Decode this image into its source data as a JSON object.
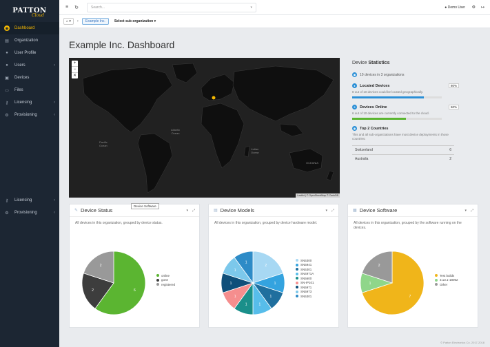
{
  "logo": {
    "line1": "PATTON",
    "line2": "Cloud"
  },
  "sidebar": {
    "items": [
      {
        "label": "Dashboard",
        "icon": "dashboard-icon",
        "glyph": "◉",
        "chev": ""
      },
      {
        "label": "Organization",
        "icon": "organization-icon",
        "glyph": "▤",
        "chev": ""
      },
      {
        "label": "User Profile",
        "icon": "user-icon",
        "glyph": "●",
        "chev": ""
      },
      {
        "label": "Users",
        "icon": "users-icon",
        "glyph": "●",
        "chev": "‹"
      },
      {
        "label": "Devices",
        "icon": "devices-icon",
        "glyph": "▣",
        "chev": ""
      },
      {
        "label": "Files",
        "icon": "files-icon",
        "glyph": "▭",
        "chev": ""
      },
      {
        "label": "Licensing",
        "icon": "key-icon",
        "glyph": "⚷",
        "chev": "‹"
      },
      {
        "label": "Provisioning",
        "icon": "gear-icon",
        "glyph": "⚙",
        "chev": "‹"
      }
    ],
    "bottom_items": [
      {
        "label": "Licensing",
        "icon": "key-icon",
        "glyph": "⚷",
        "chev": "‹"
      },
      {
        "label": "Provisioning",
        "icon": "gear-icon",
        "glyph": "⚙",
        "chev": "‹"
      }
    ]
  },
  "topbar": {
    "search_placeholder": "Search...",
    "user": "Demo User"
  },
  "breadcrumb": {
    "org": "Example Inc.",
    "sub": "Select sub-organization"
  },
  "page": {
    "title": "Example Inc. Dashboard"
  },
  "map": {
    "attribution": "Leaflet | © OpenStreetMap © CartoDB",
    "labels": {
      "atlantic": "Atlantic\nOcean",
      "pacific": "Pacific\nOcean",
      "indian": "Indian\nOcean",
      "oceania": "OCEANIA"
    }
  },
  "stats": {
    "title_prefix": "Device ",
    "title_bold": "Statistics",
    "summary": "10 devices in 3 organizations",
    "located": {
      "title": "Located Devices",
      "pct": "80%",
      "value": 0.8,
      "desc": "8 out of 10 devices could be located geographically.",
      "color": "#2a8fd6"
    },
    "online": {
      "title": "Devices Online",
      "pct": "60%",
      "value": 0.6,
      "desc": "6 out of 10 devices are currently connected to the cloud.",
      "color": "#5bb531"
    },
    "top": {
      "title": "Top 2 Countries",
      "desc": "This and all sub-organizations have most device deployments in those countries:"
    },
    "countries": [
      {
        "name": "Switzerland",
        "count": "6"
      },
      {
        "name": "Australia",
        "count": "2"
      }
    ]
  },
  "cards": {
    "status": {
      "title": "Device Status",
      "desc": "All devices in this organization, grouped by device status."
    },
    "models": {
      "title": "Device Models",
      "desc": "All devices in this organization, grouped by device hardware model."
    },
    "software": {
      "title": "Device Software",
      "desc": "All devices in this organization, grouped by the software running on the devices."
    }
  },
  "tooltip": "Device Software",
  "footer": "© Patton Electronics Co. 2017-2018",
  "chart_data": [
    {
      "type": "pie",
      "title": "Device Status",
      "categories": [
        "online",
        "gone",
        "registered"
      ],
      "values": [
        6,
        2,
        2
      ],
      "colors": [
        "#5bb531",
        "#3d3d3d",
        "#999999"
      ]
    },
    {
      "type": "pie",
      "title": "Device Models",
      "categories": [
        "SN5300",
        "SN5941",
        "SN5301",
        "SN4971A",
        "SN5600",
        "SN-IP101",
        "SN5971",
        "SN5973",
        "SN5301"
      ],
      "values": [
        2,
        1,
        1,
        1,
        1,
        1,
        1,
        1,
        1
      ],
      "colors": [
        "#a7d8f3",
        "#34a3df",
        "#1f6f9e",
        "#57bdea",
        "#1a8f8a",
        "#f58e8e",
        "#0f4f7a",
        "#7cc8eb",
        "#2d8bc7"
      ],
      "slice_labels": [
        "2",
        "1",
        "1",
        "1",
        "1",
        "1",
        "1",
        "1",
        "1"
      ]
    },
    {
      "type": "pie",
      "title": "Device Software",
      "categories": [
        "Test builds",
        "3.13.1-18062",
        "Other"
      ],
      "values": [
        7,
        1,
        2
      ],
      "colors": [
        "#f0b51a",
        "#8fd68a",
        "#999999"
      ]
    }
  ]
}
